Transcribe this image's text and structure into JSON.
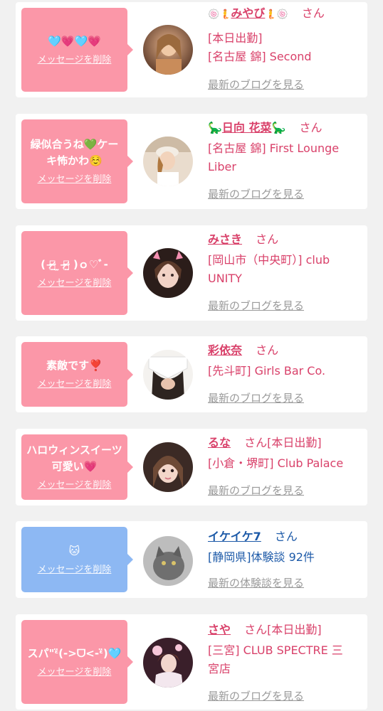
{
  "cards": [
    {
      "message": "🩵💗🩵💗",
      "delete_label": "メッセージを削除",
      "name": "みやび",
      "name_prefix": "🍥🧜",
      "name_suffix": "🧜🍥",
      "honorific": "さん",
      "status": "",
      "lines": [
        "[本日出勤]",
        "[名古屋 錦] Second"
      ],
      "link": "最新のブログを見る",
      "theme": "pink"
    },
    {
      "message": "緑似合うね💚ケーキ怖かわ☺️",
      "delete_label": "メッセージを削除",
      "name": "日向 花菜",
      "name_prefix": "🦕",
      "name_suffix": "🦕",
      "honorific": "さん",
      "status": "",
      "lines": [
        "[名古屋 錦] First Lounge",
        "Liber"
      ],
      "link": "最新のブログを見る",
      "theme": "pink"
    },
    {
      "message": "( ｏ̴̶̷̤ ̫ ｏ̴̶̷̤ )ｏ♡ﾞ-",
      "delete_label": "メッセージを削除",
      "name": "みさき",
      "name_prefix": "",
      "name_suffix": "",
      "honorific": "さん",
      "status": "",
      "lines": [
        "[岡山市（中央町）] club",
        "UNITY"
      ],
      "link": "最新のブログを見る",
      "theme": "pink"
    },
    {
      "message": "素敵です❣️",
      "delete_label": "メッセージを削除",
      "name": "彩依奈",
      "name_prefix": "",
      "name_suffix": "",
      "honorific": "さん",
      "status": "",
      "lines": [
        "[先斗町] Girls Bar Co."
      ],
      "link": "最新のブログを見る",
      "theme": "pink"
    },
    {
      "message": "ハロウィンスイーツ可愛い💗",
      "delete_label": "メッセージを削除",
      "name": "るな",
      "name_prefix": "",
      "name_suffix": "",
      "honorific": "さん",
      "status": "[本日出勤]",
      "lines": [
        "[小倉・堺町] Club Palace"
      ],
      "link": "最新のブログを見る",
      "theme": "pink"
    },
    {
      "message": "🐱",
      "delete_label": "メッセージを削除",
      "name": "イケイケ7",
      "name_prefix": "",
      "name_suffix": "",
      "honorific": "さん",
      "status": "",
      "lines": [
        "[静岡県]体験談 92件"
      ],
      "link": "最新の体験談を見る",
      "theme": "blue"
    },
    {
      "message": "スパ\"ᵋ̈(->ᗜ<-ᵋ̈)🩵",
      "delete_label": "メッセージを削除",
      "name": "さや",
      "name_prefix": "",
      "name_suffix": "",
      "honorific": "さん",
      "status": "[本日出勤]",
      "lines": [
        "[三宮] CLUB SPECTRE 三",
        "宮店"
      ],
      "link": "最新のブログを見る",
      "theme": "pink"
    }
  ]
}
